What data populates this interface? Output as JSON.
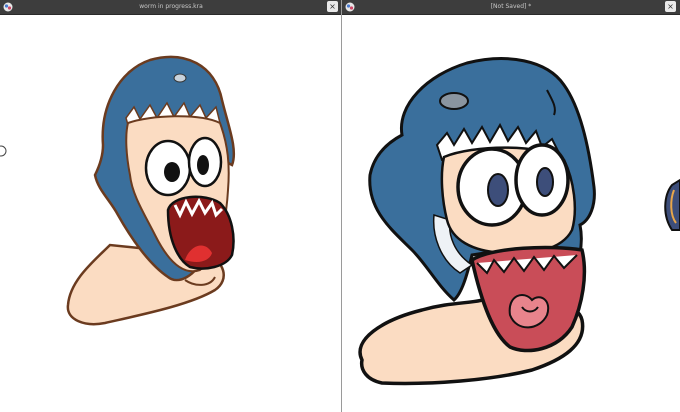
{
  "windows": [
    {
      "title": "worm in progress.kra",
      "close_icon": "×"
    },
    {
      "title": "[Not Saved]  *",
      "close_icon": "×"
    }
  ],
  "colors": {
    "titlebar": "#3d3d3d",
    "shark_blue": "#3a6f9c",
    "shark_blue_light": "#3f7eb3",
    "worm_skin": "#fbdcc2",
    "mouth_red": "#8b1a1a",
    "tongue_pink": "#e8848c",
    "outline_brown": "#6b3b1f",
    "outline_black": "#111111"
  },
  "icons": [
    "app-icon",
    "close-icon",
    "cursor-circle-icon"
  ]
}
